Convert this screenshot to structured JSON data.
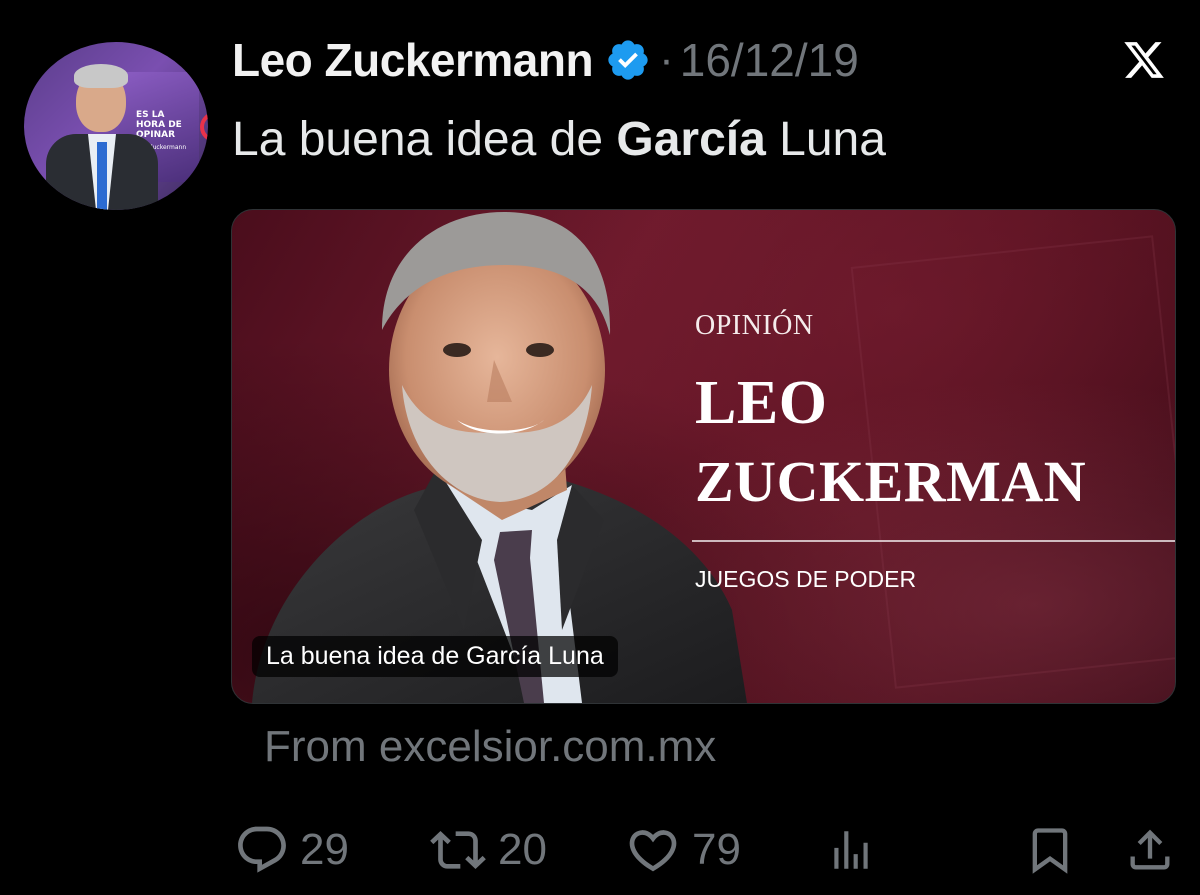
{
  "tweet": {
    "author_name": "Leo Zuckermann",
    "separator": "·",
    "date": "16/12/19",
    "text_parts": [
      "La buena idea de ",
      "García",
      " Luna"
    ],
    "avatar_text": "ES LA HORA DE OPINAR",
    "avatar_subtext": "Leo Zuckermann"
  },
  "card": {
    "label": "OPINIÓN",
    "name_line1": "LEO",
    "name_line2": "ZUCKERMAN",
    "section": "JUEGOS DE PODER",
    "caption": "La buena idea de García Luna",
    "source": "From excelsior.com.mx"
  },
  "actions": {
    "replies": "29",
    "retweets": "20",
    "likes": "79"
  },
  "icons": {
    "verified": "verified-badge-icon",
    "x_logo": "x-logo-icon",
    "reply": "speech-bubble-icon",
    "retweet": "retweet-arrows-icon",
    "like": "heart-icon",
    "views": "bar-chart-icon",
    "bookmark": "bookmark-icon",
    "share": "share-upload-icon"
  },
  "colors": {
    "background": "#000000",
    "text": "#e7e9ea",
    "muted": "#71767b",
    "verified_blue": "#1d9bf0",
    "card_maroon": "#6e1a2c"
  }
}
